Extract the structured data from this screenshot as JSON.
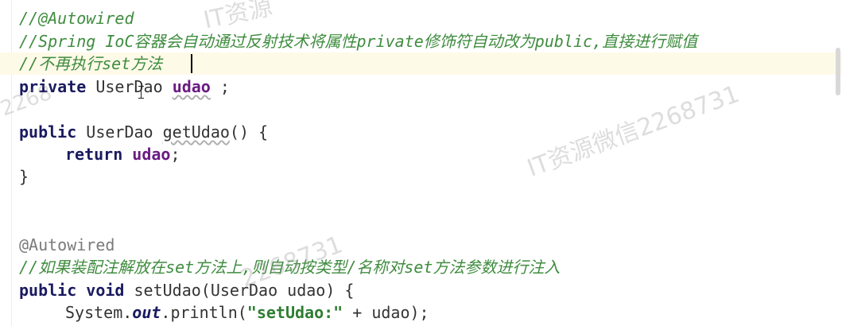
{
  "code": {
    "line1": "//@Autowired",
    "line2": "//Spring IoC容器会自动通过反射技术将属性private修饰符自动改为public,直接进行赋值",
    "line3": "//不再执行set方法",
    "line4": {
      "kw": "private",
      "type": "UserDao",
      "field": "udao",
      "tail": " ;"
    },
    "line6": {
      "kw": "public",
      "sig_a": " UserDao ",
      "method": "getUdao",
      "sig_b": "() {"
    },
    "line7": {
      "kw": "return",
      "field": "udao",
      "tail": ";"
    },
    "line8": "}",
    "line11": "@Autowired",
    "line12": "//如果装配注解放在set方法上,则自动按类型/名称对set方法参数进行注入",
    "line13": {
      "kw1": "public",
      "kw2": "void",
      "rest": " setUdao(UserDao udao) {"
    },
    "line14": {
      "a": "System.",
      "static": "out",
      "b": ".println(",
      "str": "\"setUdao:\"",
      "c": " + udao);"
    }
  },
  "watermarks": {
    "w1": "IT资源",
    "w2": "2268",
    "w3": "IT资源微信2268731",
    "w4": "2268731"
  }
}
